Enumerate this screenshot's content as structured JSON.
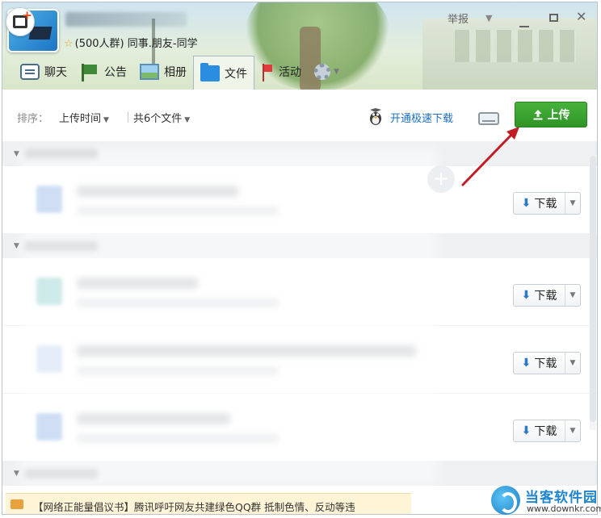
{
  "header": {
    "group_subtitle": "(500人群) 同事.朋友-同学",
    "report_label": "举报",
    "window_controls": {
      "minimize": "minimize",
      "maximize": "maximize",
      "close": "close"
    }
  },
  "tabs": [
    {
      "label": "聊天",
      "icon": "chat-icon"
    },
    {
      "label": "公告",
      "icon": "notice-flag-icon"
    },
    {
      "label": "相册",
      "icon": "album-icon"
    },
    {
      "label": "文件",
      "icon": "folder-icon",
      "active": true
    },
    {
      "label": "活动",
      "icon": "activity-flag-icon"
    }
  ],
  "sortbar": {
    "sort_label": "排序：",
    "sort_value": "上传时间",
    "file_count": "共6个文件",
    "speed_download": "开通极速下载",
    "upload_button": "上传"
  },
  "file_list": {
    "download_label": "下载"
  },
  "banner": {
    "text": "【网络正能量倡议书】腾讯呼吁网友共建绿色QQ群 抵制色情、反动等违"
  },
  "watermark": {
    "title": "当客软件园",
    "url": "www.downkr.com"
  },
  "colors": {
    "accent_green": "#3aa22f",
    "link_blue": "#1b6fc6",
    "annotation_red": "#c21d24"
  }
}
